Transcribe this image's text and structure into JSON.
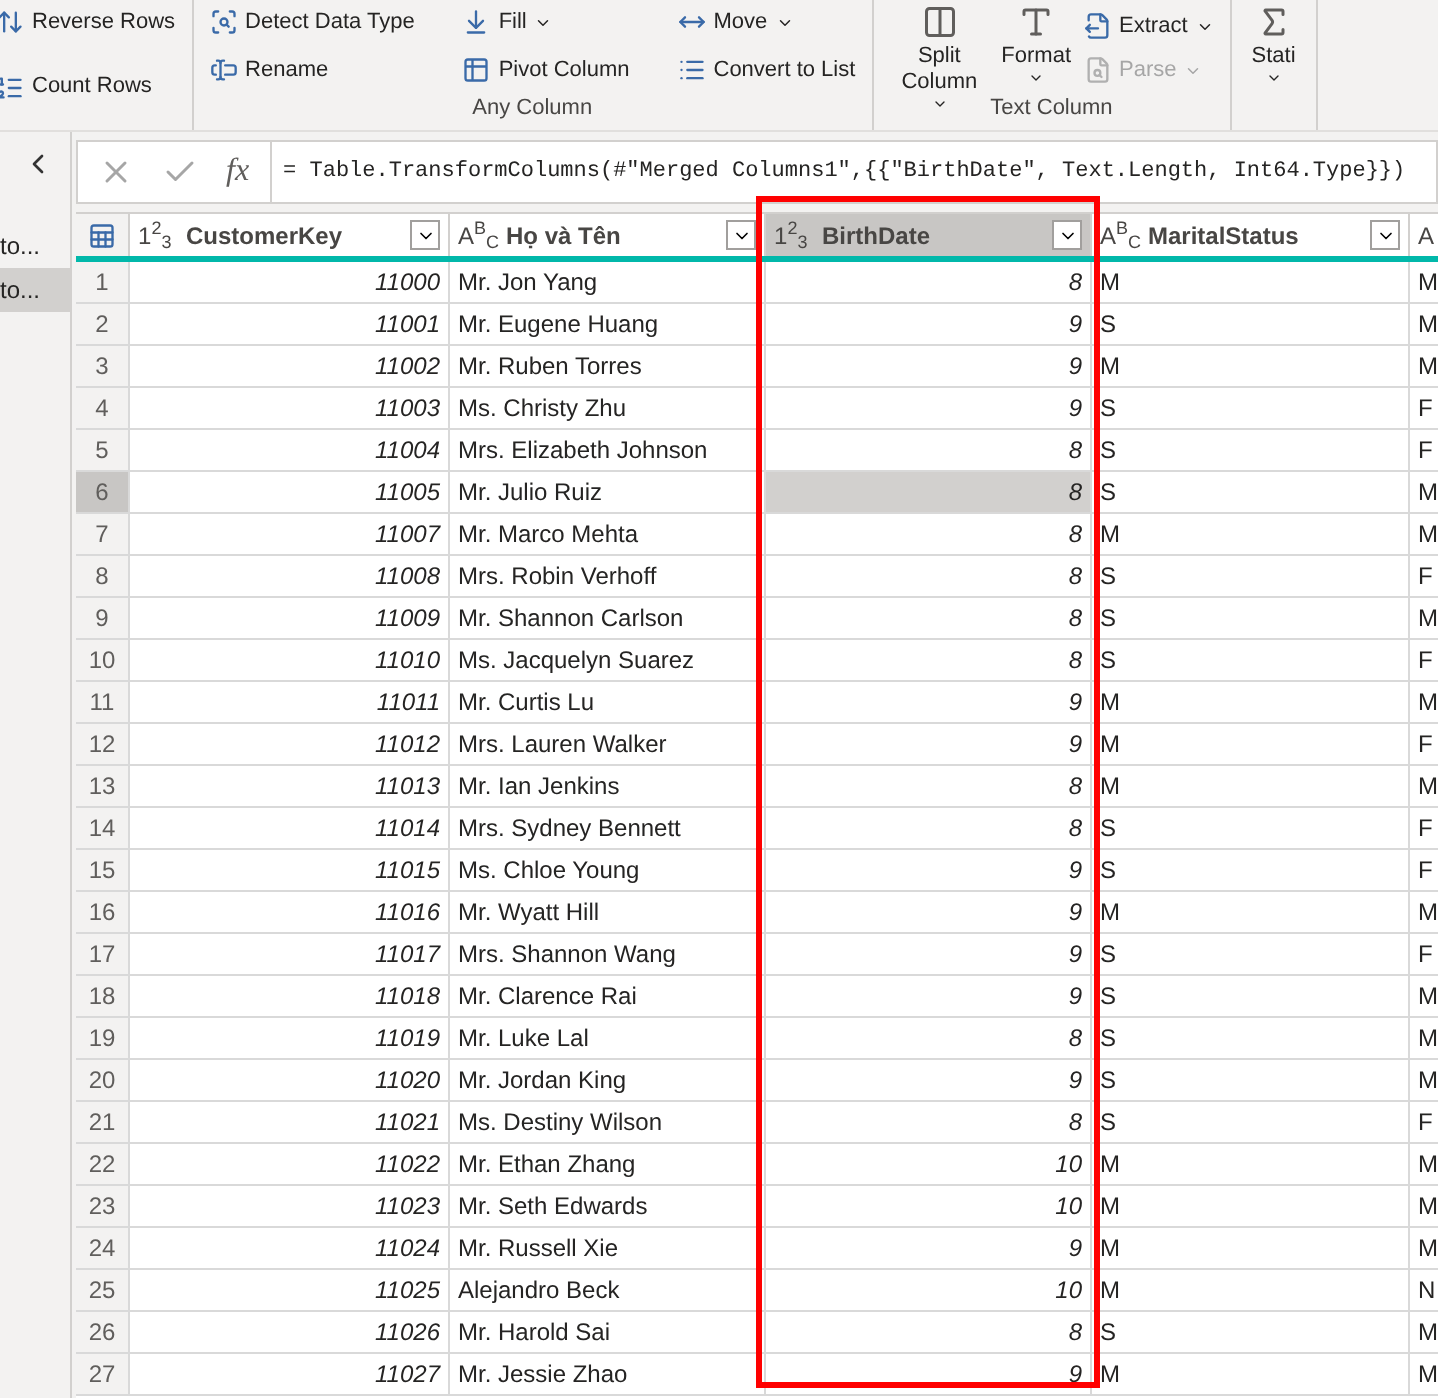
{
  "ribbon": {
    "groups": [
      {
        "items": [
          {
            "kind": "reverse",
            "label": "Reverse Rows",
            "dropdown": false,
            "disabled": false
          },
          {
            "kind": "count",
            "label": "Count Rows",
            "dropdown": false,
            "disabled": false
          }
        ]
      },
      {
        "label": "Any Column",
        "items": [
          {
            "kind": "detect",
            "label": "Detect Data Type",
            "dropdown": false,
            "disabled": false
          },
          {
            "kind": "rename",
            "label": "Rename",
            "dropdown": false,
            "disabled": false
          },
          {
            "kind": "fill",
            "label": "Fill",
            "dropdown": true,
            "disabled": false
          },
          {
            "kind": "pivot",
            "label": "Pivot Column",
            "dropdown": false,
            "disabled": false
          },
          {
            "kind": "move",
            "label": "Move",
            "dropdown": true,
            "disabled": false
          },
          {
            "kind": "convert",
            "label": "Convert to List",
            "dropdown": false,
            "disabled": false
          }
        ]
      },
      {
        "label": "Text Column",
        "items": [
          {
            "kind": "split",
            "label": "Split Column",
            "dropdown": true,
            "disabled": false
          },
          {
            "kind": "format",
            "label": "Format",
            "dropdown": true,
            "disabled": false
          },
          {
            "kind": "extract",
            "label": "Extract",
            "dropdown": true,
            "disabled": false
          },
          {
            "kind": "parse",
            "label": "Parse",
            "dropdown": true,
            "disabled": true
          }
        ]
      },
      {
        "items": [
          {
            "kind": "stats",
            "label": "Stati",
            "dropdown": true,
            "disabled": false
          }
        ]
      }
    ]
  },
  "queries": [
    {
      "label": "to...",
      "selected": false
    },
    {
      "label": "to...",
      "selected": true
    }
  ],
  "formula": {
    "fx": "fx",
    "text": "= Table.TransformColumns(#\"Merged Columns1\",{{\"BirthDate\", Text.Length, Int64.Type}})"
  },
  "table": {
    "columns": [
      {
        "kind": "number",
        "type_icon": "1$^{2}$$_{3}$",
        "name": "CustomerKey",
        "selected": false
      },
      {
        "kind": "text",
        "type_icon": "A$^{B}$$_{C}$",
        "name": "Họ và Tên",
        "selected": false
      },
      {
        "kind": "number",
        "type_icon": "1$^{2}$$_{3}$",
        "name": "BirthDate",
        "selected": true
      },
      {
        "kind": "text",
        "type_icon": "A$^{B}$$_{C}$",
        "name": "MaritalStatus",
        "selected": false
      },
      {
        "kind": "text",
        "type_icon": "A",
        "selected": false
      }
    ],
    "rows": [
      {
        "number": "1",
        "cells": [
          "11000",
          "Mr. Jon Yang",
          "8",
          "M",
          "M"
        ],
        "selected": false
      },
      {
        "number": "2",
        "cells": [
          "11001",
          "Mr. Eugene Huang",
          "9",
          "S",
          "M"
        ],
        "selected": false
      },
      {
        "number": "3",
        "cells": [
          "11002",
          "Mr. Ruben Torres",
          "9",
          "M",
          "M"
        ],
        "selected": false
      },
      {
        "number": "4",
        "cells": [
          "11003",
          "Ms. Christy Zhu",
          "9",
          "S",
          "F"
        ],
        "selected": false
      },
      {
        "number": "5",
        "cells": [
          "11004",
          "Mrs. Elizabeth Johnson",
          "8",
          "S",
          "F"
        ],
        "selected": false
      },
      {
        "number": "6",
        "cells": [
          "11005",
          "Mr. Julio Ruiz",
          "8",
          "S",
          "M"
        ],
        "selected": true
      },
      {
        "number": "7",
        "cells": [
          "11007",
          "Mr. Marco Mehta",
          "8",
          "M",
          "M"
        ],
        "selected": false
      },
      {
        "number": "8",
        "cells": [
          "11008",
          "Mrs. Robin Verhoff",
          "8",
          "S",
          "F"
        ],
        "selected": false
      },
      {
        "number": "9",
        "cells": [
          "11009",
          "Mr. Shannon Carlson",
          "8",
          "S",
          "M"
        ],
        "selected": false
      },
      {
        "number": "10",
        "cells": [
          "11010",
          "Ms. Jacquelyn Suarez",
          "8",
          "S",
          "F"
        ],
        "selected": false
      },
      {
        "number": "11",
        "cells": [
          "11011",
          "Mr. Curtis Lu",
          "9",
          "M",
          "M"
        ],
        "selected": false
      },
      {
        "number": "12",
        "cells": [
          "11012",
          "Mrs. Lauren Walker",
          "9",
          "M",
          "F"
        ],
        "selected": false
      },
      {
        "number": "13",
        "cells": [
          "11013",
          "Mr. Ian Jenkins",
          "8",
          "M",
          "M"
        ],
        "selected": false
      },
      {
        "number": "14",
        "cells": [
          "11014",
          "Mrs. Sydney Bennett",
          "8",
          "S",
          "F"
        ],
        "selected": false
      },
      {
        "number": "15",
        "cells": [
          "11015",
          "Ms. Chloe Young",
          "9",
          "S",
          "F"
        ],
        "selected": false
      },
      {
        "number": "16",
        "cells": [
          "11016",
          "Mr. Wyatt Hill",
          "9",
          "M",
          "M"
        ],
        "selected": false
      },
      {
        "number": "17",
        "cells": [
          "11017",
          "Mrs. Shannon Wang",
          "9",
          "S",
          "F"
        ],
        "selected": false
      },
      {
        "number": "18",
        "cells": [
          "11018",
          "Mr. Clarence Rai",
          "9",
          "S",
          "M"
        ],
        "selected": false
      },
      {
        "number": "19",
        "cells": [
          "11019",
          "Mr. Luke Lal",
          "8",
          "S",
          "M"
        ],
        "selected": false
      },
      {
        "number": "20",
        "cells": [
          "11020",
          "Mr. Jordan King",
          "9",
          "S",
          "M"
        ],
        "selected": false
      },
      {
        "number": "21",
        "cells": [
          "11021",
          "Ms. Destiny Wilson",
          "8",
          "S",
          "F"
        ],
        "selected": false
      },
      {
        "number": "22",
        "cells": [
          "11022",
          "Mr. Ethan Zhang",
          "10",
          "M",
          "M"
        ],
        "selected": false
      },
      {
        "number": "23",
        "cells": [
          "11023",
          "Mr. Seth Edwards",
          "10",
          "M",
          "M"
        ],
        "selected": false
      },
      {
        "number": "24",
        "cells": [
          "11024",
          "Mr. Russell Xie",
          "9",
          "M",
          "M"
        ],
        "selected": false
      },
      {
        "number": "25",
        "cells": [
          "11025",
          "Alejandro Beck",
          "10",
          "M",
          "N"
        ],
        "selected": false
      },
      {
        "number": "26",
        "cells": [
          "11026",
          "Mr. Harold Sai",
          "8",
          "S",
          "M"
        ],
        "selected": false
      },
      {
        "number": "27",
        "cells": [
          "11027",
          "Mr. Jessie Zhao",
          "9",
          "M",
          "M"
        ],
        "selected": false
      }
    ]
  }
}
